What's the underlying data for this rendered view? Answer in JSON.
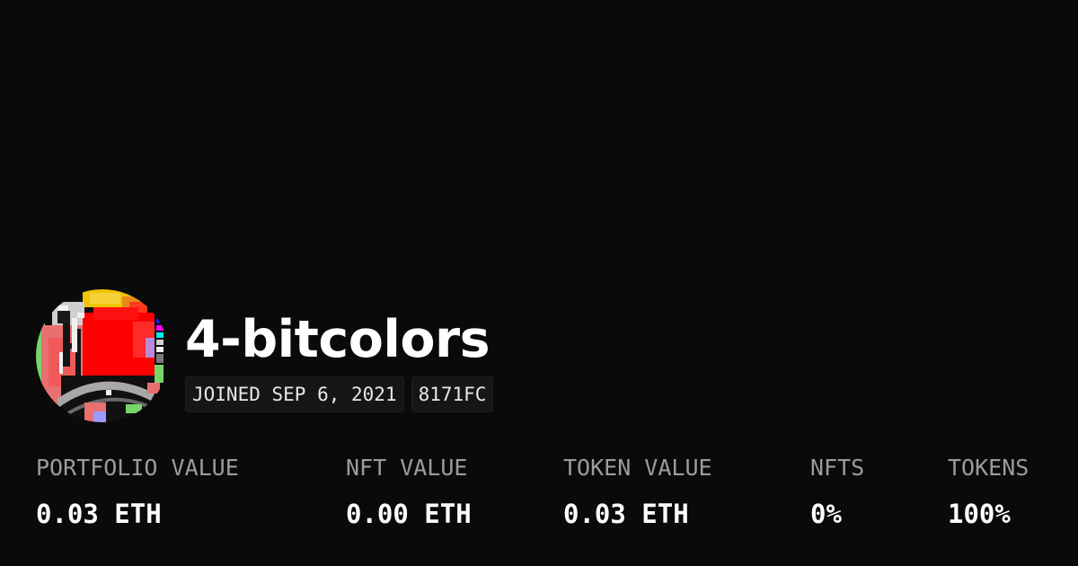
{
  "profile": {
    "username": "4-bitcolors",
    "joined": "JOINED SEP 6, 2021",
    "address_tag": "8171FC",
    "avatar_icon": "pixel-art-avatar"
  },
  "stats": [
    {
      "label": "PORTFOLIO VALUE",
      "value": "0.03 ETH"
    },
    {
      "label": "NFT VALUE",
      "value": "0.00 ETH"
    },
    {
      "label": "TOKEN VALUE",
      "value": "0.03 ETH"
    },
    {
      "label": "NFTS",
      "value": "0%"
    },
    {
      "label": "TOKENS",
      "value": "100%"
    }
  ],
  "colors": {
    "background": "#0a0a0a",
    "text": "#ffffff",
    "label": "#9c9c9c",
    "badge_bg": "#161616"
  }
}
